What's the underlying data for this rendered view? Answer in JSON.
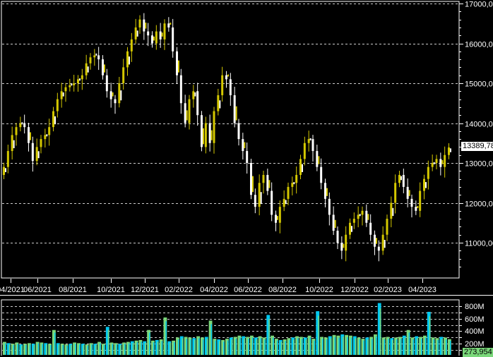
{
  "chart_data": [
    {
      "type": "candlestick",
      "title": "",
      "granularity": "weekly (approximated)",
      "x_tick_labels": [
        "04/2021",
        "06/2021",
        "08/2021",
        "10/2021",
        "12/2021",
        "02/2022",
        "04/2022",
        "06/2022",
        "08/2022",
        "10/2022",
        "12/2022",
        "02/2023",
        "04/2023"
      ],
      "y_tick_labels": [
        "17000,00",
        "16000,00",
        "15000,00",
        "14000,00",
        "13000,00",
        "12000,00",
        "11000,00"
      ],
      "y_ticks": [
        17000,
        16000,
        15000,
        14000,
        13000,
        12000,
        11000
      ],
      "ylim": [
        10300,
        17050
      ],
      "grid": true,
      "last_value_label": "13389,78",
      "colors": {
        "up": "#d4c800",
        "down": "#ffffff"
      },
      "closes": [
        12900,
        13300,
        13700,
        13900,
        14000,
        13900,
        13500,
        13050,
        13400,
        13600,
        13700,
        13900,
        14300,
        14600,
        14800,
        14900,
        14950,
        15000,
        15100,
        15200,
        15500,
        15650,
        15700,
        15600,
        15200,
        14800,
        14600,
        14500,
        15000,
        15400,
        15800,
        16100,
        16400,
        16600,
        16300,
        16200,
        16000,
        16300,
        16100,
        16500,
        16400,
        15800,
        15200,
        14500,
        14000,
        14600,
        14800,
        14200,
        13400,
        14000,
        13500,
        14300,
        14700,
        15200,
        15100,
        14700,
        14000,
        13600,
        13300,
        13000,
        12200,
        11900,
        12500,
        12700,
        12300,
        11700,
        11500,
        11900,
        12100,
        12400,
        12500,
        12700,
        13100,
        13500,
        13600,
        13300,
        12900,
        12500,
        12100,
        11700,
        11300,
        11000,
        10800,
        11200,
        11500,
        11600,
        11700,
        11800,
        11500,
        11200,
        10900,
        10800,
        11200,
        11600,
        12000,
        12500,
        12700,
        12400,
        12100,
        11900,
        11800,
        12300,
        12600,
        12900,
        13000,
        13100,
        12900,
        13200,
        13390
      ]
    },
    {
      "type": "bar",
      "title": "Volume",
      "y_tick_labels": [
        "800M",
        "600M",
        "400M",
        "200M"
      ],
      "y_ticks": [
        800,
        600,
        400,
        200
      ],
      "ylim": [
        0,
        870
      ],
      "unit": "M",
      "last_value_label": "273,954",
      "colors": {
        "a": "#7ad87a",
        "b": "#00c8f0"
      },
      "values": [
        230,
        210,
        200,
        220,
        190,
        200,
        210,
        200,
        230,
        220,
        210,
        200,
        420,
        210,
        200,
        190,
        200,
        220,
        210,
        200,
        190,
        210,
        200,
        230,
        200,
        470,
        220,
        210,
        200,
        220,
        230,
        240,
        250,
        260,
        240,
        420,
        250,
        260,
        270,
        620,
        240,
        250,
        300,
        320,
        310,
        300,
        290,
        320,
        300,
        310,
        570,
        280,
        270,
        260,
        280,
        300,
        310,
        330,
        320,
        310,
        330,
        300,
        320,
        300,
        660,
        330,
        280,
        260,
        270,
        290,
        300,
        320,
        310,
        300,
        330,
        280,
        720,
        310,
        300,
        320,
        340,
        330,
        350,
        340,
        330,
        320,
        300,
        280,
        300,
        310,
        350,
        850,
        300,
        310,
        290,
        300,
        310,
        330,
        420,
        300,
        320,
        310,
        330,
        710,
        300,
        290,
        310,
        300,
        274
      ]
    }
  ]
}
